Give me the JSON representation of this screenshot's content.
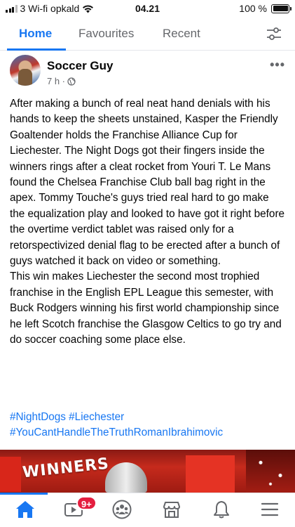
{
  "status_bar": {
    "carrier": "3 Wi-fi opkald",
    "time": "04.21",
    "battery": "100 %"
  },
  "tabs": [
    {
      "label": "Home"
    },
    {
      "label": "Favourites"
    },
    {
      "label": "Recent"
    }
  ],
  "post": {
    "author": "Soccer Guy",
    "time_ago": "7 h ·",
    "body": "After making a bunch of real neat hand denials with his hands to keep the sheets unstained, Kasper the Friendly Goaltender holds the Franchise Alliance Cup for Liechester. The Night Dogs got their fingers inside the winners rings after a cleat rocket from Youri T. Le Mans found the Chelsea Franchise Club ball bag right in the apex. Tommy Touche's guys tried real hard to go make the equalization play and looked to have got it right before the overtime verdict tablet was raised only for a retorspectivized denial flag to be erected after a bunch of guys watched it back on video or something.\nThis win makes Liechester the second most trophied franchise in the English EPL League this semester, with Buck Rodgers winning his first world championship since he left Scotch franchise the Glasgow Celtics to go try and do soccer coaching some place else.",
    "hashtags": [
      "#NightDogs #Liechester",
      "#YouCantHandleTheTruthRomanIbrahimovic"
    ],
    "image_banner_text": "WINNERS"
  },
  "bottom_nav": {
    "video_badge": "9+"
  },
  "colors": {
    "accent": "#1877f2",
    "badge": "#e41e3f"
  }
}
